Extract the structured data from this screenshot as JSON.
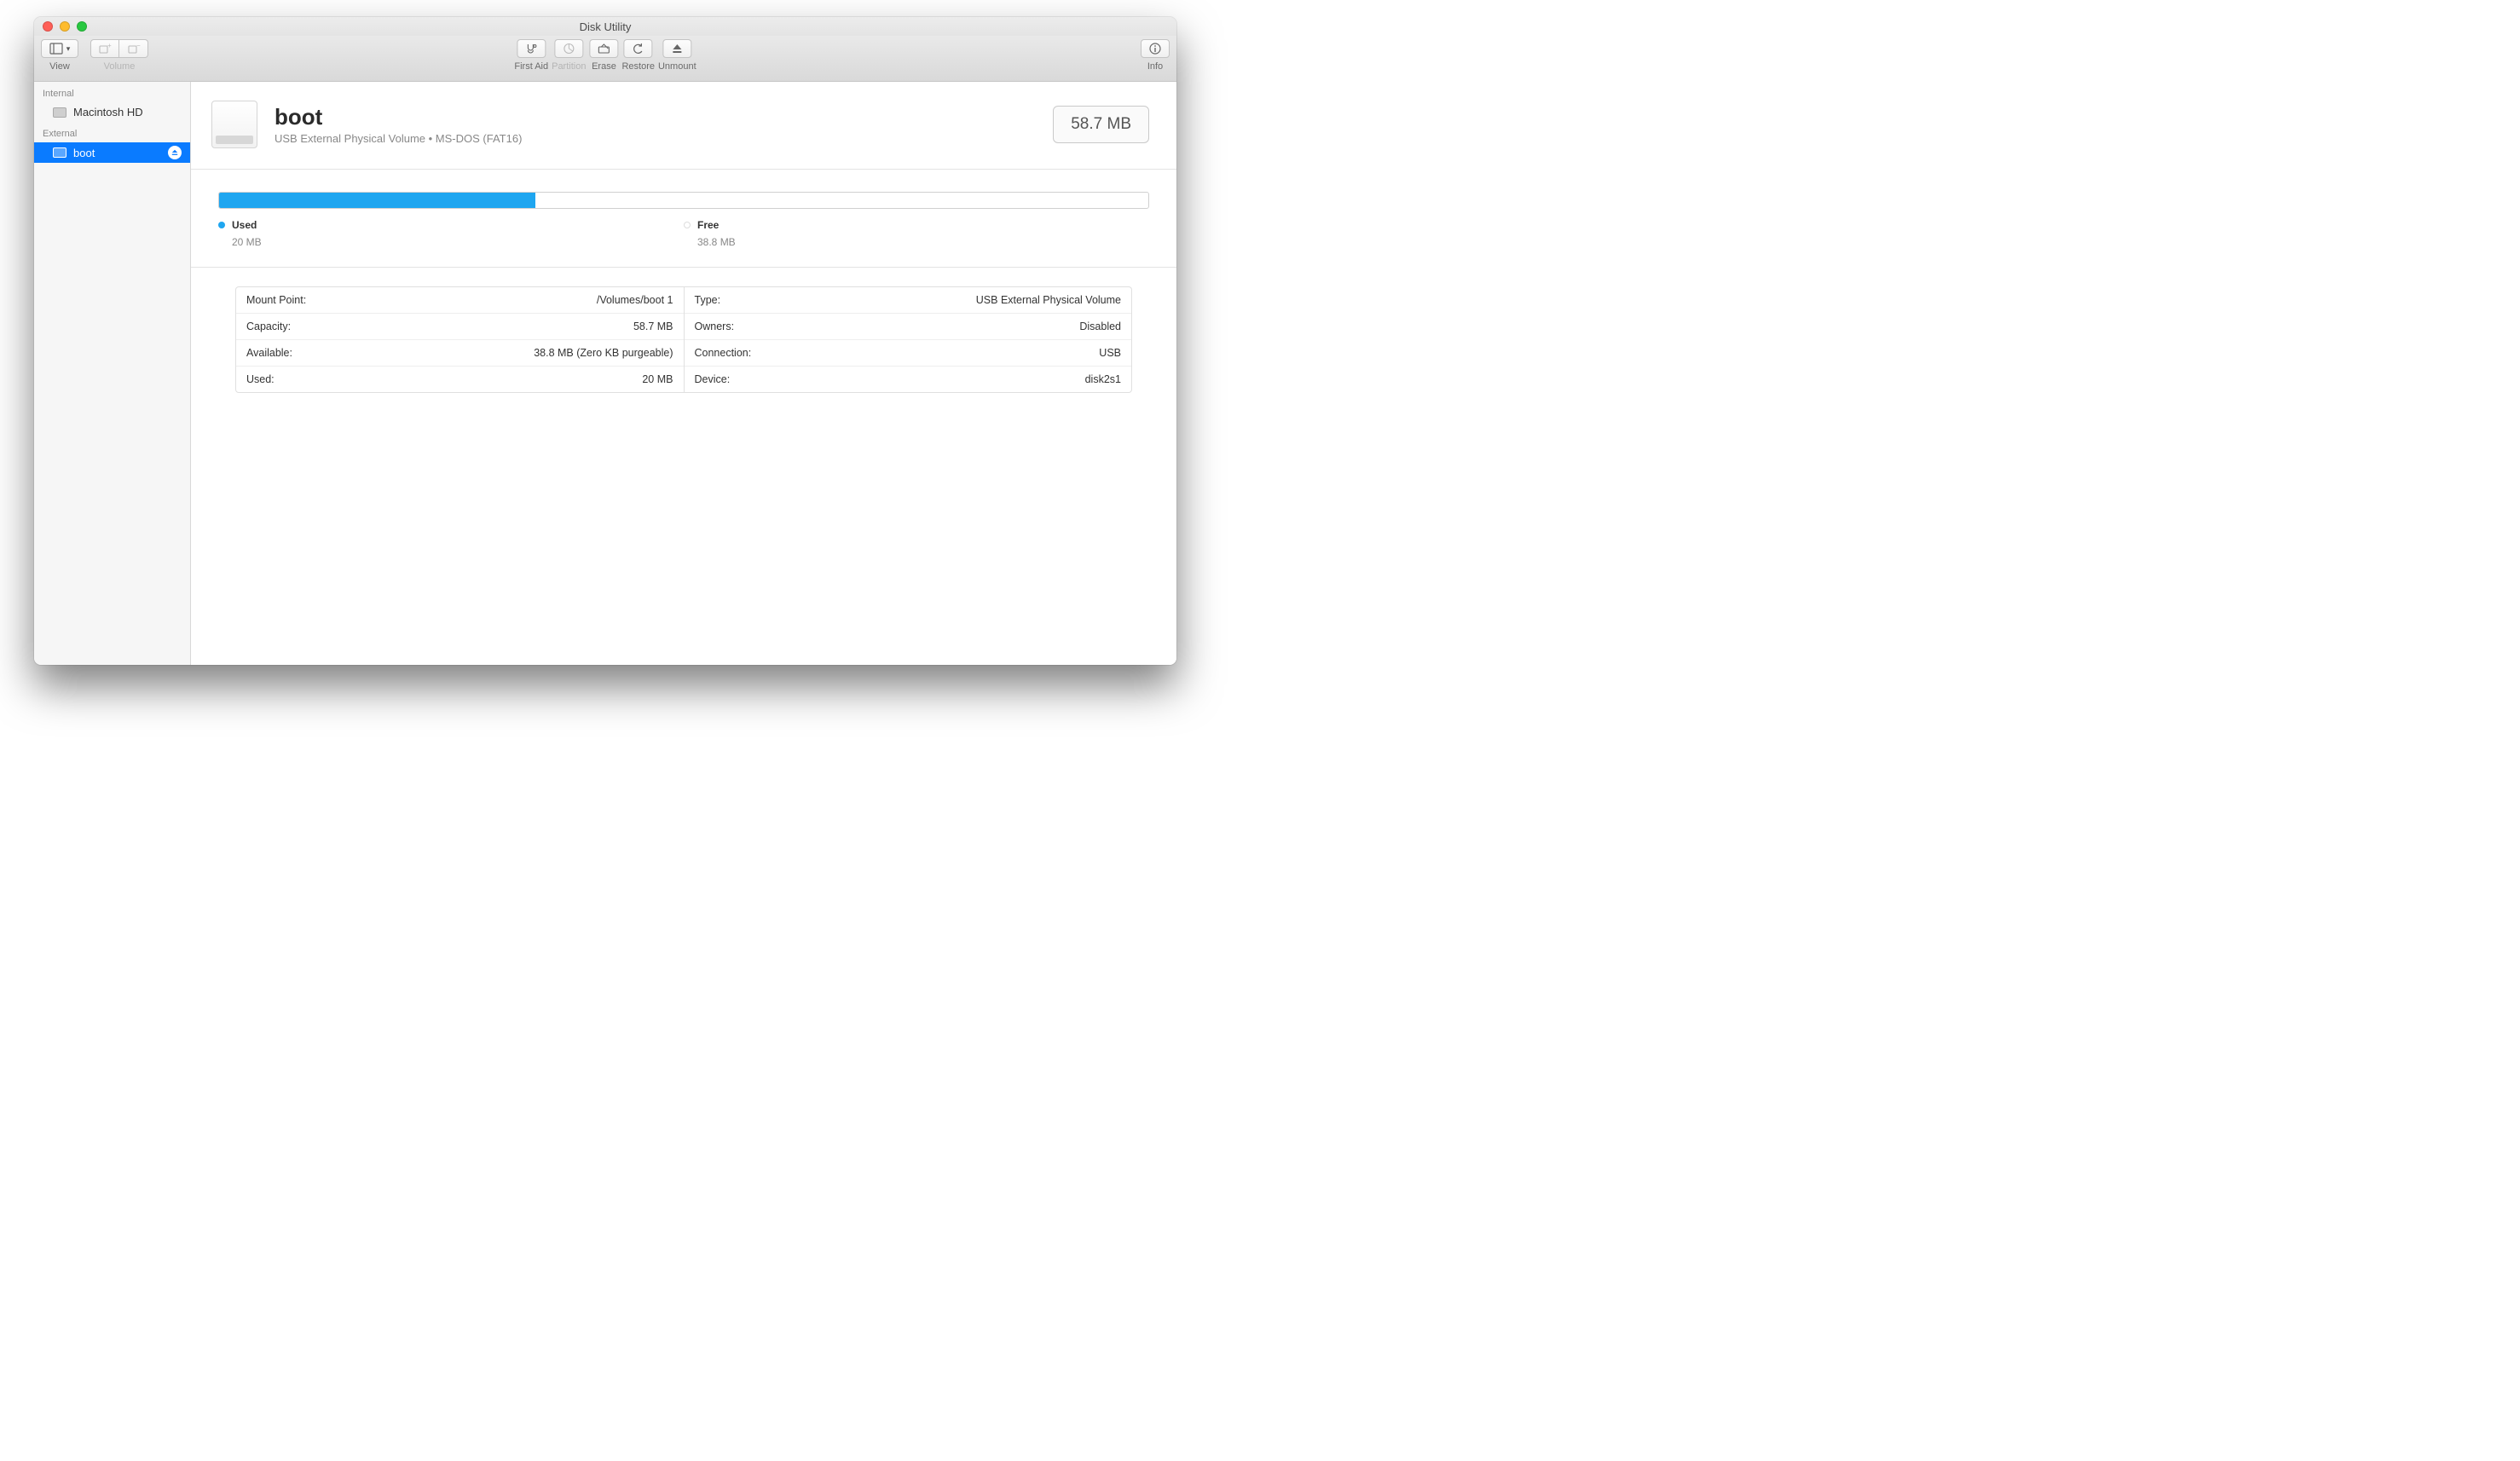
{
  "window": {
    "title": "Disk Utility"
  },
  "toolbar": {
    "view": {
      "label": "View"
    },
    "volume": {
      "label": "Volume"
    },
    "first_aid": {
      "label": "First Aid"
    },
    "partition": {
      "label": "Partition"
    },
    "erase": {
      "label": "Erase"
    },
    "restore": {
      "label": "Restore"
    },
    "unmount": {
      "label": "Unmount"
    },
    "info": {
      "label": "Info"
    }
  },
  "sidebar": {
    "internal_header": "Internal",
    "external_header": "External",
    "internal": [
      {
        "label": "Macintosh HD"
      }
    ],
    "external": [
      {
        "label": "boot"
      }
    ]
  },
  "volume": {
    "name": "boot",
    "subtitle": "USB External Physical Volume • MS-DOS (FAT16)",
    "total_size": "58.7 MB"
  },
  "usage": {
    "used_label": "Used",
    "used_value": "20 MB",
    "free_label": "Free",
    "free_value": "38.8 MB",
    "used_percent": 34,
    "used_color": "#1fa6f0",
    "free_color": "#ffffff"
  },
  "details": {
    "left": [
      {
        "k": "Mount Point:",
        "v": "/Volumes/boot 1"
      },
      {
        "k": "Capacity:",
        "v": "58.7 MB"
      },
      {
        "k": "Available:",
        "v": "38.8 MB (Zero KB purgeable)"
      },
      {
        "k": "Used:",
        "v": "20 MB"
      }
    ],
    "right": [
      {
        "k": "Type:",
        "v": "USB External Physical Volume"
      },
      {
        "k": "Owners:",
        "v": "Disabled"
      },
      {
        "k": "Connection:",
        "v": "USB"
      },
      {
        "k": "Device:",
        "v": "disk2s1"
      }
    ]
  }
}
